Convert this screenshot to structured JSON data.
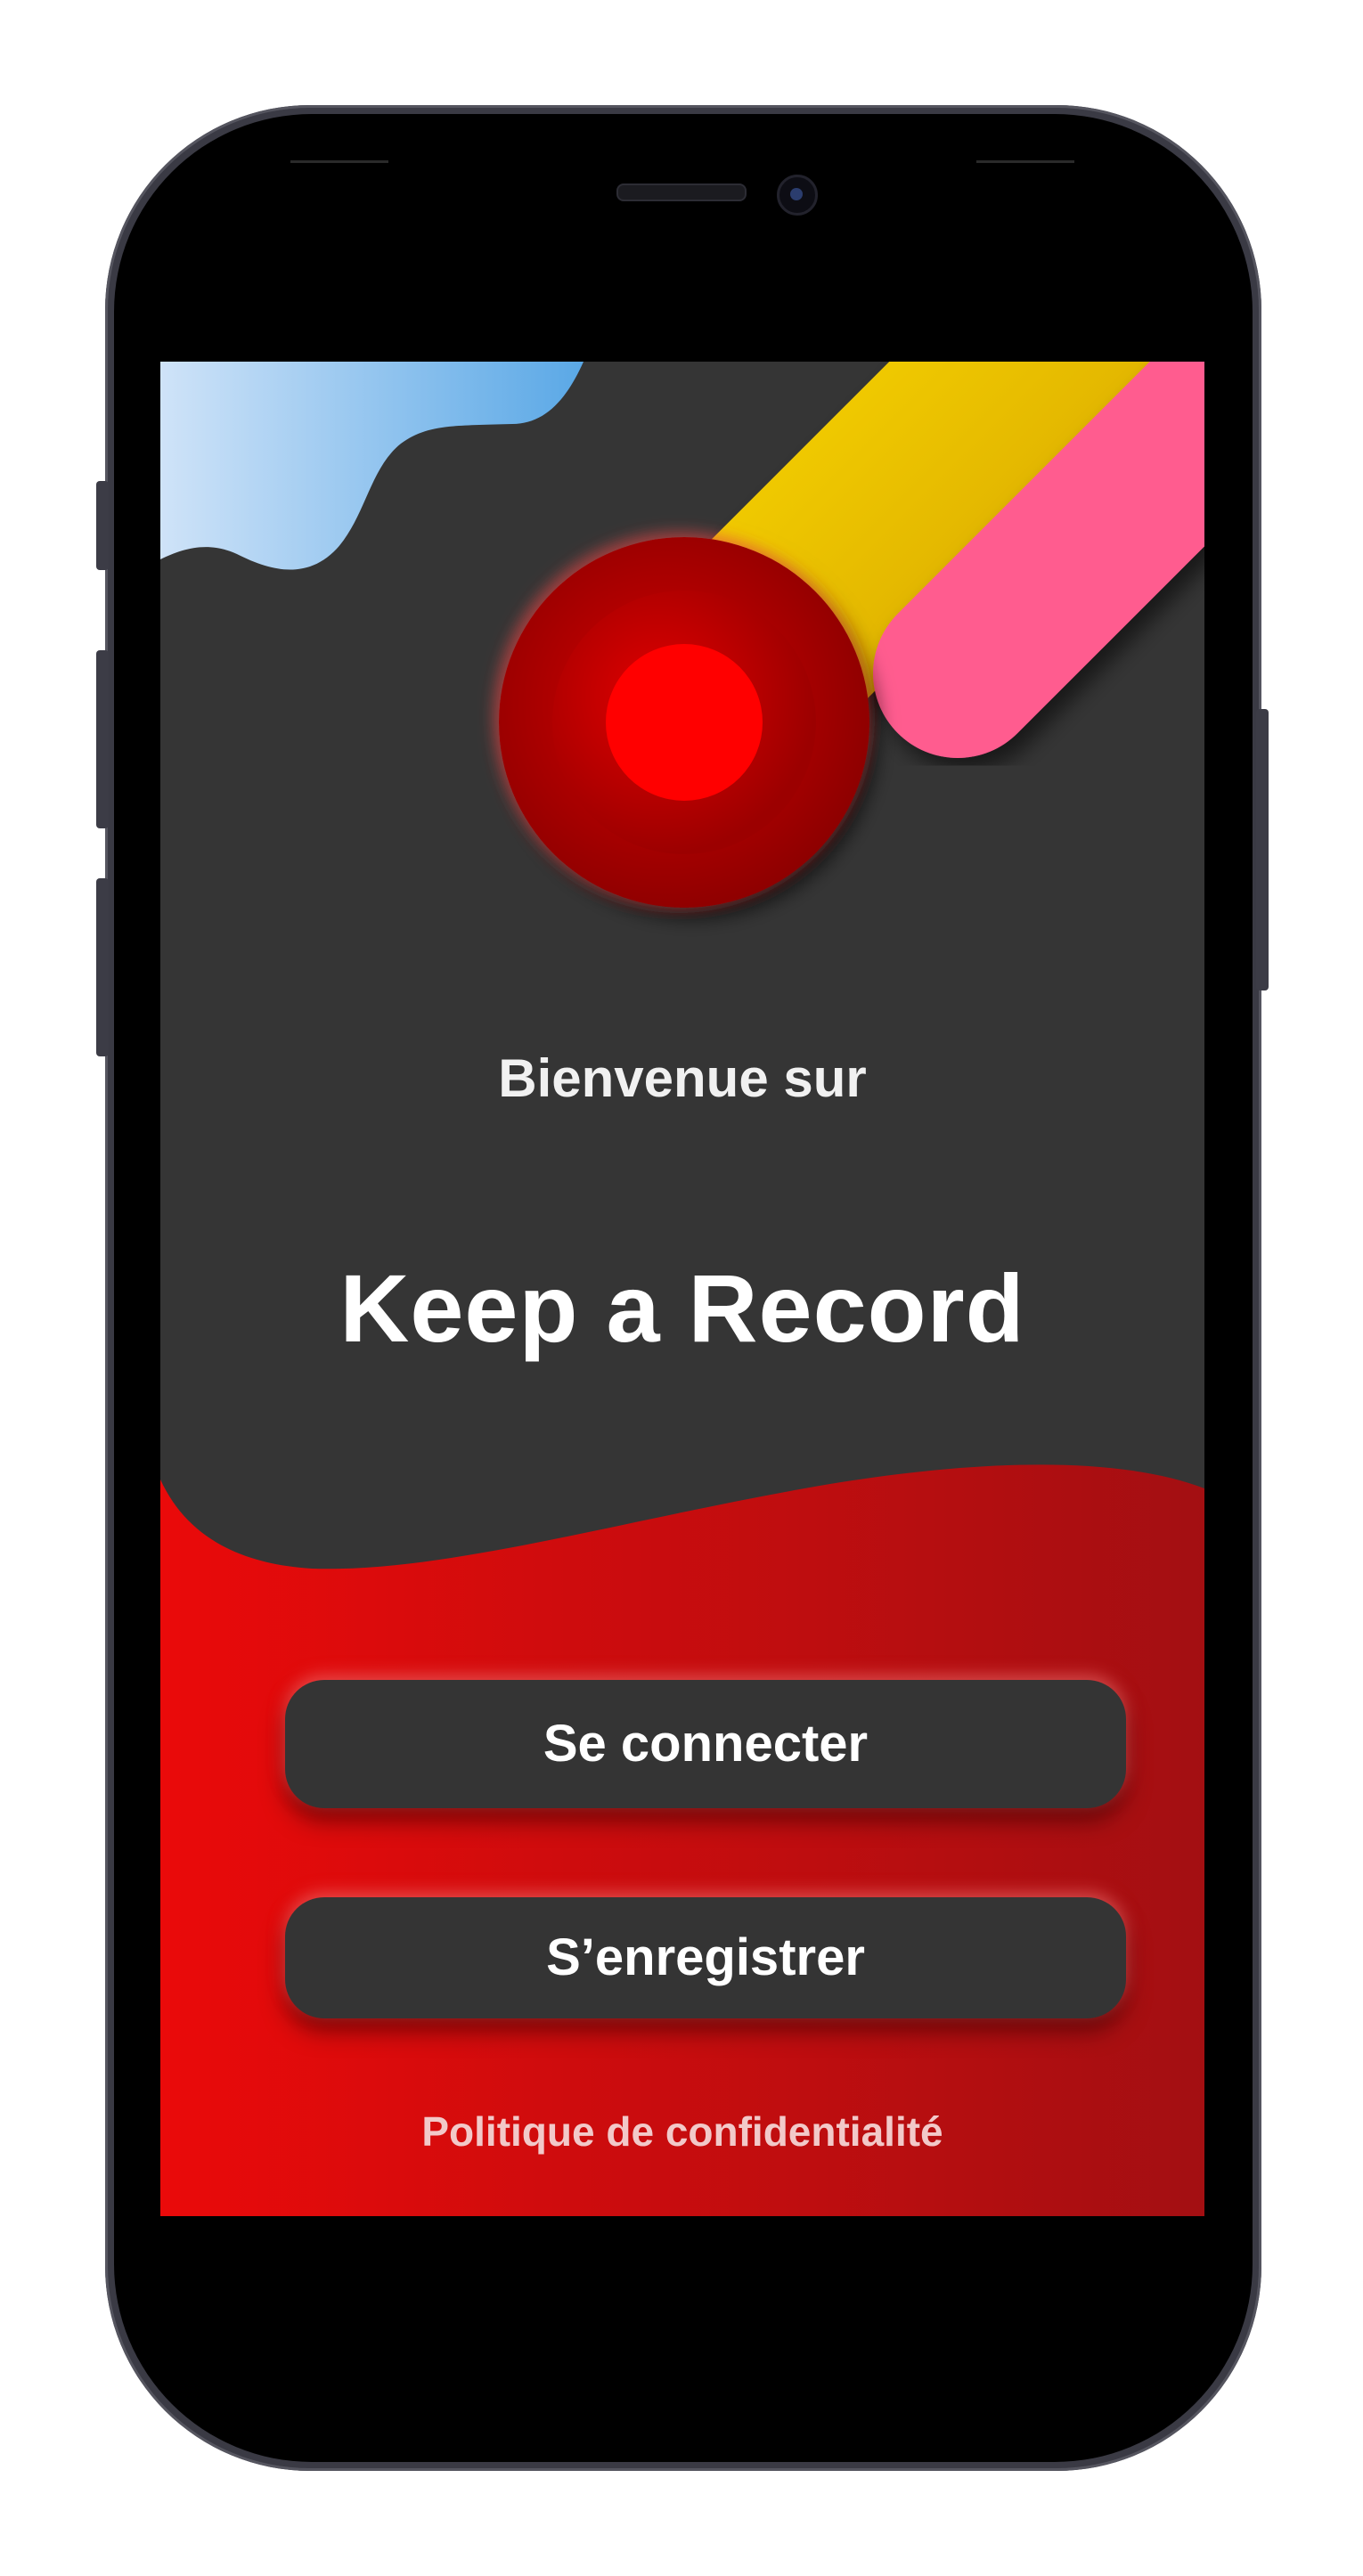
{
  "screen": {
    "welcome_text": "Bienvenue sur",
    "app_title": "Keep a Record"
  },
  "actions": {
    "login_label": "Se connecter",
    "register_label": "S’enregistrer",
    "privacy_label": "Politique de confidentialité"
  },
  "colors": {
    "background_dark": "#353535",
    "brand_red": "#e80808",
    "accent_yellow": "#f2cc00",
    "accent_pink": "#ff5b8f",
    "accent_blue": "#62a9e6"
  },
  "icons": {
    "logo": "record-button-icon"
  }
}
